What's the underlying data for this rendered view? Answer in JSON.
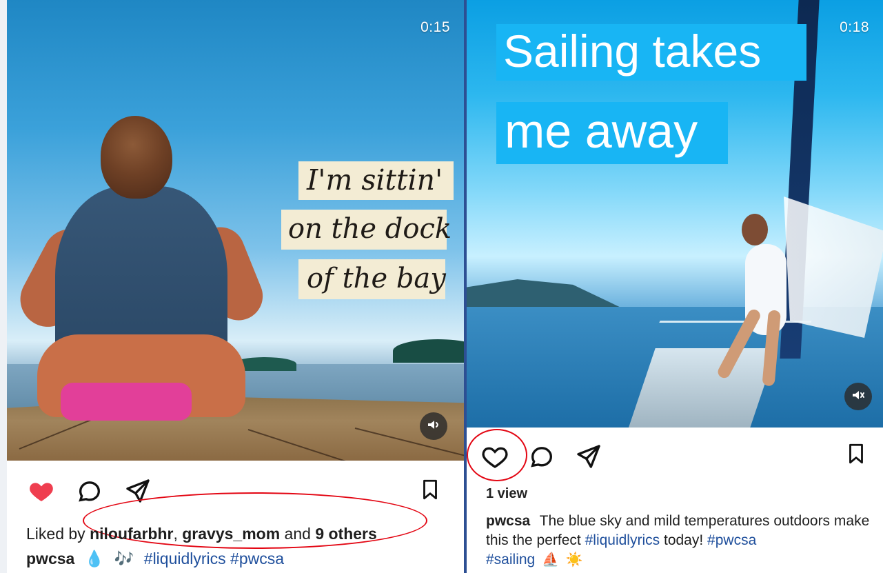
{
  "left_post": {
    "duration": "0:15",
    "overlay_lines": [
      "I'm sittin'",
      "on the dock",
      "of the bay"
    ],
    "likes_prefix": "Liked by",
    "liked_user_one": "niloufarbhr",
    "liked_user_two": "gravys_mom",
    "likes_middle": "and",
    "likes_others": "9 others",
    "caption_username": "pwcsa",
    "caption_emoji_1": "💧",
    "caption_emoji_2": "🎶",
    "caption_tag_1": "#liquidlyrics",
    "caption_tag_2": "#pwcsa",
    "like_state": "liked"
  },
  "right_post": {
    "duration": "0:18",
    "overlay_lines": [
      "Sailing takes",
      "me away"
    ],
    "views": "1 view",
    "caption_username": "pwcsa",
    "caption_text_1": "The blue sky and mild temperatures outdoors make this the perfect",
    "caption_tag_1": "#liquidlyrics",
    "caption_text_2": "today!",
    "caption_tag_2": "#pwcsa",
    "caption_tag_3": "#sailing",
    "caption_emoji_1": "⛵",
    "caption_emoji_2": "☀️",
    "like_state": "unliked"
  },
  "colors": {
    "page_border": "#2d4f93",
    "highlight": "#e30613",
    "heart": "#ef3e4f",
    "link": "#1f4f9c",
    "overlay_blue": "#18b5f4"
  },
  "icons": {
    "like_filled": "heart-icon",
    "like_outline": "heart-outline-icon",
    "comment": "comment-icon",
    "share": "share-icon",
    "save": "bookmark-icon",
    "audio_on": "speaker-icon",
    "audio_off": "mute-icon"
  }
}
